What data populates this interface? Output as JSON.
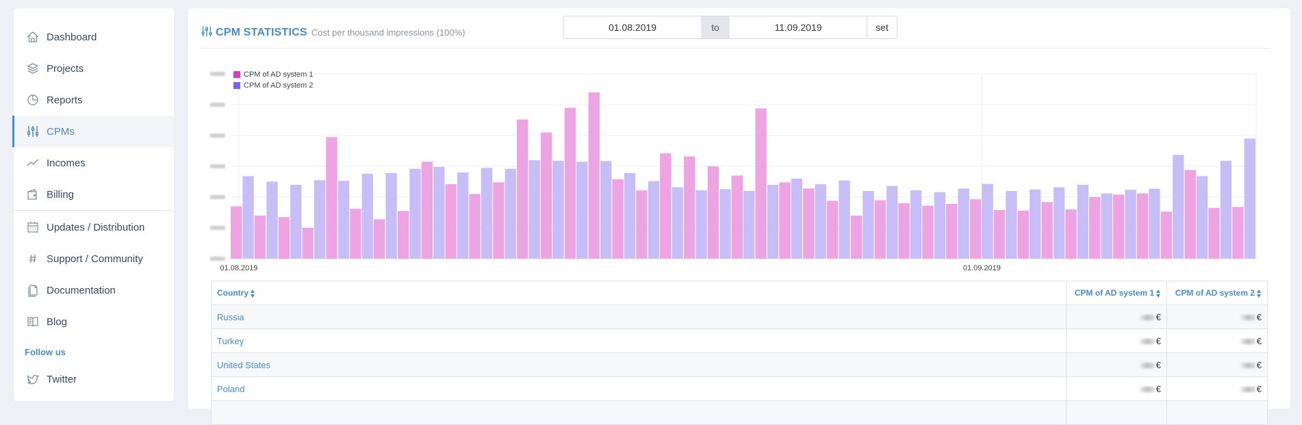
{
  "sidebar": {
    "items": [
      {
        "label": "Dashboard",
        "icon": "home-icon"
      },
      {
        "label": "Projects",
        "icon": "layers-icon"
      },
      {
        "label": "Reports",
        "icon": "pie-icon"
      },
      {
        "label": "CPMs",
        "icon": "sliders-icon",
        "active": true
      },
      {
        "label": "Incomes",
        "icon": "trend-icon"
      },
      {
        "label": "Billing",
        "icon": "wallet-icon"
      },
      {
        "label": "Updates / Distribution",
        "icon": "calendar-icon"
      },
      {
        "label": "Support / Community",
        "icon": "hash-icon"
      },
      {
        "label": "Documentation",
        "icon": "docs-icon"
      },
      {
        "label": "Blog",
        "icon": "book-icon"
      }
    ],
    "follow_label": "Follow us",
    "social": [
      {
        "label": "Twitter",
        "icon": "twitter-icon"
      }
    ]
  },
  "header": {
    "title": "CPM STATISTICS",
    "subtitle": "Cost per thousand impressions (100%)"
  },
  "date_range": {
    "from": "01.08.2019",
    "separator": "to",
    "to": "11.09.2019",
    "set_label": "set"
  },
  "chart_data": {
    "type": "bar",
    "x_tick_labels": [
      "01.08.2019",
      "01.09.2019"
    ],
    "x_tick_index": [
      0,
      31
    ],
    "ylim": [
      0,
      6
    ],
    "grid": true,
    "legend_position": "top-left",
    "series": [
      {
        "name": "CPM of AD system 1",
        "color": "#e987d9",
        "values": [
          1.7,
          1.4,
          1.35,
          1.0,
          3.95,
          1.62,
          1.28,
          1.55,
          3.15,
          2.42,
          2.1,
          2.48,
          4.52,
          4.1,
          4.9,
          5.4,
          2.58,
          2.22,
          3.42,
          3.32,
          3.0,
          2.7,
          4.88,
          2.48,
          2.28,
          1.88,
          1.4,
          1.9,
          1.8,
          1.72,
          1.78,
          1.93,
          1.58,
          1.56,
          1.84,
          1.6,
          2.0,
          2.08,
          2.12,
          1.53,
          2.88,
          1.65,
          1.68
        ]
      },
      {
        "name": "CPM of AD system 2",
        "color": "#a996f2",
        "values": [
          2.68,
          2.5,
          2.4,
          2.55,
          2.53,
          2.76,
          2.78,
          2.92,
          2.98,
          2.8,
          2.95,
          2.92,
          3.2,
          3.18,
          3.15,
          3.17,
          2.78,
          2.52,
          2.32,
          2.22,
          2.26,
          2.2,
          2.4,
          2.6,
          2.42,
          2.54,
          2.2,
          2.36,
          2.22,
          2.16,
          2.28,
          2.43,
          2.2,
          2.25,
          2.32,
          2.4,
          2.12,
          2.24,
          2.27,
          3.37,
          2.68,
          3.18,
          3.9
        ]
      }
    ]
  },
  "table": {
    "headers": [
      "Country",
      "CPM of AD system 1",
      "CPM of AD system 2"
    ],
    "rows": [
      {
        "country": "Russia",
        "a": "€",
        "b": "€"
      },
      {
        "country": "Turkey",
        "a": "€",
        "b": "€"
      },
      {
        "country": "United States",
        "a": "€",
        "b": "€"
      },
      {
        "country": "Poland",
        "a": "€",
        "b": "€"
      },
      {
        "country": "",
        "a": "",
        "b": ""
      }
    ]
  },
  "colors": {
    "accent": "#4a8bc2"
  }
}
